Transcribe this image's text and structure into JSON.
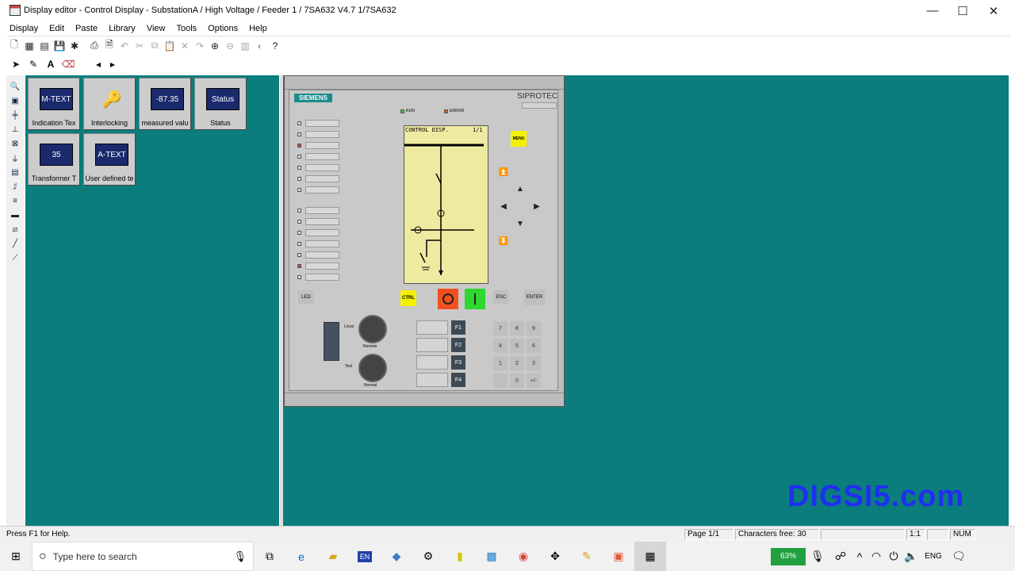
{
  "window": {
    "title": "Display editor - Control Display - SubstationA / High Voltage / Feeder 1 / 7SA632 V4.7 1/7SA632",
    "min_glyph": "—",
    "max_glyph": "☐",
    "close_glyph": "✕"
  },
  "menu": [
    "Display",
    "Edit",
    "Paste",
    "Library",
    "View",
    "Tools",
    "Options",
    "Help"
  ],
  "library": {
    "items": [
      {
        "label": "Indication Tex",
        "icon_text": "M-TEXT"
      },
      {
        "label": "Interlocking",
        "icon_text": "🔑"
      },
      {
        "label": "measured valu",
        "icon_text": "-87.35"
      },
      {
        "label": "Status",
        "icon_text": "Status"
      },
      {
        "label": "Transformer T",
        "icon_text": "35"
      },
      {
        "label": "User defined te",
        "icon_text": "A-TEXT"
      }
    ]
  },
  "device": {
    "brand_siemens": "SIEMENS",
    "brand_siprotec": "SIPROTEC",
    "led_run": "RUN",
    "led_error": "ERROR",
    "lcd_header": "CONTROL DISP.",
    "lcd_page": "1/1",
    "menu_key": "MENU",
    "ctrl_key": "CTRL",
    "esc_key": "ESC",
    "enter_key": "ENTER",
    "led_key": "LED",
    "local_label": "Local",
    "remote_label": "Remote",
    "test_label": "Test",
    "normal_label": "Normal",
    "f_keys": [
      "F1",
      "F2",
      "F3",
      "F4"
    ],
    "keypad": [
      "7",
      "8",
      "9",
      "4",
      "5",
      "6",
      "1",
      "2",
      "3",
      "",
      "0",
      "+/-"
    ]
  },
  "status_bar": {
    "help": "Press F1 for Help.",
    "page": "Page 1/1",
    "chars": "Characters free: 30",
    "zoom": "1:1",
    "num": "NUM"
  },
  "taskbar": {
    "search_placeholder": "Type here to search",
    "battery": "63%",
    "language": "ENG"
  },
  "watermark": "DIGSI5.com"
}
